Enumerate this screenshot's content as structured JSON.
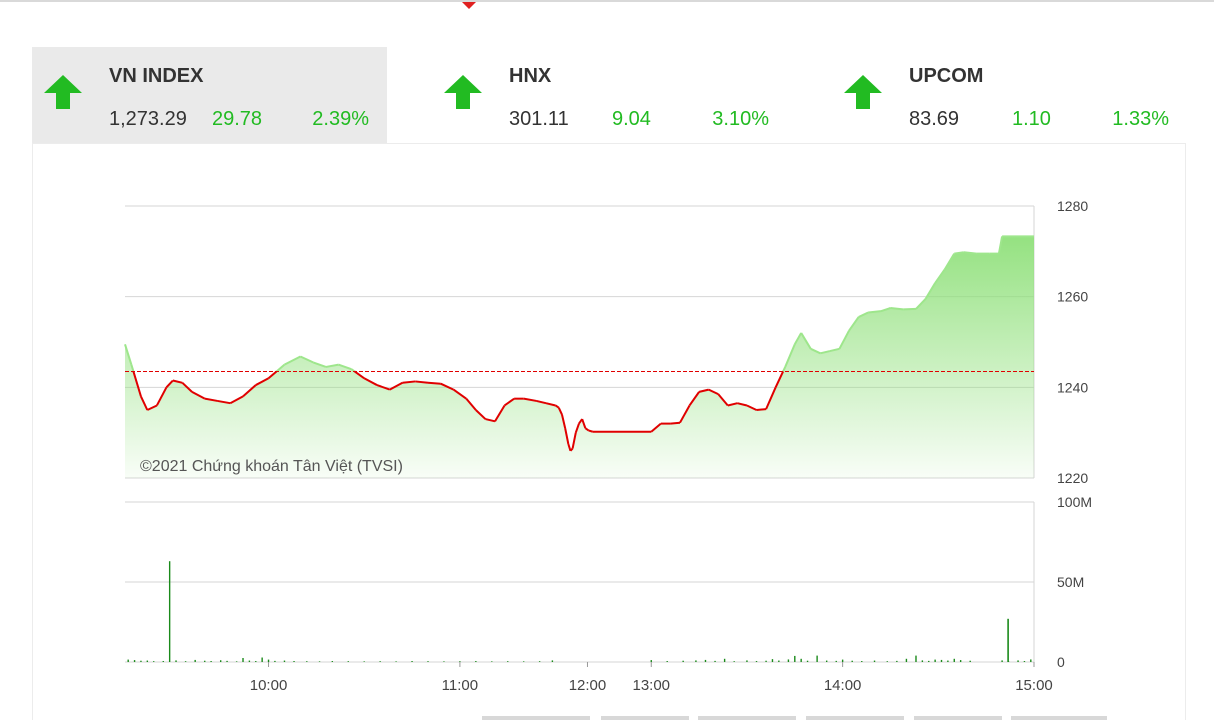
{
  "indices": [
    {
      "name": "VN INDEX",
      "value": "1,273.29",
      "change": "29.78",
      "percent": "2.39%",
      "active": true
    },
    {
      "name": "HNX",
      "value": "301.11",
      "change": "9.04",
      "percent": "3.10%",
      "active": false
    },
    {
      "name": "UPCOM",
      "value": "83.69",
      "change": "1.10",
      "percent": "1.33%",
      "active": false
    }
  ],
  "colors": {
    "up": "#22bb22",
    "line_below": "#e00000",
    "area_fill": "#8fe07a",
    "reference_line": "#e00000",
    "volume_bar": "#1a8a1a",
    "grid": "#d6d6d6"
  },
  "chart_data": [
    {
      "type": "line",
      "series_name": "",
      "watermark": "©2021 Chứng khoán Tân Việt (TVSI)",
      "x_ticks": [
        "10:00",
        "11:00",
        "12:00",
        "13:00",
        "14:00",
        "15:00"
      ],
      "y_ticks": [
        1220,
        1240,
        1260,
        1280
      ],
      "ylim": [
        1220,
        1280
      ],
      "xlim": [
        "09:15",
        "15:00"
      ],
      "reference_value": 1243.5,
      "grid": true,
      "points": [
        [
          "09:15",
          1249.5
        ],
        [
          "09:17",
          1245
        ],
        [
          "09:20",
          1238
        ],
        [
          "09:22",
          1235
        ],
        [
          "09:25",
          1236
        ],
        [
          "09:28",
          1240
        ],
        [
          "09:30",
          1241.5
        ],
        [
          "09:33",
          1241
        ],
        [
          "09:36",
          1239
        ],
        [
          "09:40",
          1237.5
        ],
        [
          "09:44",
          1237
        ],
        [
          "09:48",
          1236.5
        ],
        [
          "09:52",
          1238
        ],
        [
          "09:56",
          1240.5
        ],
        [
          "10:00",
          1242
        ],
        [
          "10:05",
          1245
        ],
        [
          "10:10",
          1246.8
        ],
        [
          "10:14",
          1245.5
        ],
        [
          "10:18",
          1244.5
        ],
        [
          "10:22",
          1245
        ],
        [
          "10:26",
          1244
        ],
        [
          "10:30",
          1242
        ],
        [
          "10:34",
          1240.5
        ],
        [
          "10:38",
          1239.5
        ],
        [
          "10:42",
          1241
        ],
        [
          "10:46",
          1241.3
        ],
        [
          "10:50",
          1241
        ],
        [
          "10:54",
          1240.8
        ],
        [
          "10:58",
          1239.5
        ],
        [
          "11:02",
          1237.5
        ],
        [
          "11:05",
          1235
        ],
        [
          "11:08",
          1233
        ],
        [
          "11:11",
          1232.5
        ],
        [
          "11:14",
          1236
        ],
        [
          "11:17",
          1237.5
        ],
        [
          "11:20",
          1237.5
        ],
        [
          "11:24",
          1237
        ],
        [
          "11:27",
          1236.5
        ],
        [
          "11:30",
          1236
        ],
        [
          "11:33",
          1235.5
        ],
        [
          "11:36",
          1234
        ],
        [
          "11:39",
          1231
        ],
        [
          "11:42",
          1227.5
        ],
        [
          "11:44",
          1226
        ],
        [
          "11:46",
          1226.5
        ],
        [
          "11:49",
          1230
        ],
        [
          "11:52",
          1232
        ],
        [
          "11:55",
          1233
        ],
        [
          "11:58",
          1231
        ],
        [
          "12:01",
          1230.5
        ],
        [
          "12:05",
          1230.2
        ],
        [
          "13:00",
          1230.2
        ],
        [
          "13:03",
          1232
        ],
        [
          "13:06",
          1232
        ],
        [
          "13:09",
          1232.2
        ],
        [
          "13:12",
          1236
        ],
        [
          "13:15",
          1239
        ],
        [
          "13:18",
          1239.5
        ],
        [
          "13:21",
          1238.5
        ],
        [
          "13:24",
          1236
        ],
        [
          "13:27",
          1236.5
        ],
        [
          "13:30",
          1236
        ],
        [
          "13:33",
          1235
        ],
        [
          "13:36",
          1235.2
        ],
        [
          "13:39",
          1240
        ],
        [
          "13:42",
          1244.5
        ],
        [
          "13:45",
          1249.5
        ],
        [
          "13:47",
          1252
        ],
        [
          "13:50",
          1248.5
        ],
        [
          "13:53",
          1247.5
        ],
        [
          "13:56",
          1248
        ],
        [
          "13:59",
          1248.5
        ],
        [
          "14:02",
          1252.5
        ],
        [
          "14:05",
          1255.5
        ],
        [
          "14:08",
          1256.5
        ],
        [
          "14:12",
          1256.8
        ],
        [
          "14:15",
          1257.5
        ],
        [
          "14:19",
          1257.2
        ],
        [
          "14:23",
          1257.3
        ],
        [
          "14:26",
          1259.5
        ],
        [
          "14:29",
          1263
        ],
        [
          "14:32",
          1266
        ],
        [
          "14:35",
          1269.5
        ],
        [
          "14:38",
          1269.8
        ],
        [
          "14:42",
          1269.5
        ],
        [
          "14:46",
          1269.5
        ],
        [
          "14:49",
          1269.5
        ],
        [
          "14:50",
          1273.3
        ],
        [
          "15:00",
          1273.3
        ]
      ]
    },
    {
      "type": "bar",
      "series_name": "",
      "y_ticks": [
        "0",
        "50M",
        "100M"
      ],
      "ylim": [
        0,
        100
      ],
      "x_ticks": [
        "10:00",
        "11:00",
        "12:00",
        "13:00",
        "14:00",
        "15:00"
      ],
      "unit": "M",
      "bars": [
        [
          "09:16",
          1.5
        ],
        [
          "09:18",
          1.2
        ],
        [
          "09:20",
          0.8
        ],
        [
          "09:22",
          0.9
        ],
        [
          "09:24",
          0.5
        ],
        [
          "09:27",
          0.6
        ],
        [
          "09:29",
          63
        ],
        [
          "09:31",
          1.0
        ],
        [
          "09:34",
          0.5
        ],
        [
          "09:37",
          1.3
        ],
        [
          "09:40",
          0.8
        ],
        [
          "09:42",
          0.6
        ],
        [
          "09:45",
          1.1
        ],
        [
          "09:47",
          0.7
        ],
        [
          "09:50",
          0.4
        ],
        [
          "09:52",
          2.5
        ],
        [
          "09:54",
          0.9
        ],
        [
          "09:56",
          0.6
        ],
        [
          "09:58",
          2.8
        ],
        [
          "10:00",
          1.5
        ],
        [
          "10:02",
          0.7
        ],
        [
          "10:05",
          0.9
        ],
        [
          "10:08",
          0.6
        ],
        [
          "10:12",
          0.5
        ],
        [
          "10:16",
          0.4
        ],
        [
          "10:20",
          0.6
        ],
        [
          "10:25",
          0.5
        ],
        [
          "10:30",
          0.4
        ],
        [
          "10:35",
          0.5
        ],
        [
          "10:40",
          0.4
        ],
        [
          "10:45",
          0.6
        ],
        [
          "10:50",
          0.5
        ],
        [
          "10:55",
          0.4
        ],
        [
          "11:00",
          0.5
        ],
        [
          "11:05",
          0.6
        ],
        [
          "11:10",
          0.4
        ],
        [
          "11:15",
          0.5
        ],
        [
          "11:20",
          0.4
        ],
        [
          "11:25",
          0.5
        ],
        [
          "11:29",
          1.0
        ],
        [
          "13:00",
          1.2
        ],
        [
          "13:05",
          0.6
        ],
        [
          "13:10",
          0.8
        ],
        [
          "13:14",
          1.0
        ],
        [
          "13:17",
          1.3
        ],
        [
          "13:20",
          0.7
        ],
        [
          "13:23",
          2.0
        ],
        [
          "13:26",
          0.5
        ],
        [
          "13:30",
          1.0
        ],
        [
          "13:33",
          0.6
        ],
        [
          "13:36",
          0.8
        ],
        [
          "13:38",
          1.8
        ],
        [
          "13:40",
          0.9
        ],
        [
          "13:43",
          1.6
        ],
        [
          "13:45",
          3.8
        ],
        [
          "13:47",
          2.0
        ],
        [
          "13:49",
          0.8
        ],
        [
          "13:52",
          4.0
        ],
        [
          "13:55",
          0.9
        ],
        [
          "13:58",
          0.7
        ],
        [
          "14:00",
          1.5
        ],
        [
          "14:03",
          0.8
        ],
        [
          "14:06",
          0.6
        ],
        [
          "14:10",
          0.9
        ],
        [
          "14:14",
          0.5
        ],
        [
          "14:17",
          0.7
        ],
        [
          "14:20",
          2.0
        ],
        [
          "14:23",
          4.0
        ],
        [
          "14:25",
          1.0
        ],
        [
          "14:27",
          0.7
        ],
        [
          "14:29",
          1.5
        ],
        [
          "14:31",
          1.3
        ],
        [
          "14:33",
          0.9
        ],
        [
          "14:35",
          2.0
        ],
        [
          "14:37",
          1.2
        ],
        [
          "14:40",
          0.8
        ],
        [
          "14:50",
          1.0
        ],
        [
          "14:52",
          0.5
        ],
        [
          "14:55",
          1.0
        ],
        [
          "14:57",
          0.6
        ],
        [
          "14:59",
          1.6
        ]
      ],
      "atc_bar": [
        "14:50",
        27
      ]
    }
  ]
}
